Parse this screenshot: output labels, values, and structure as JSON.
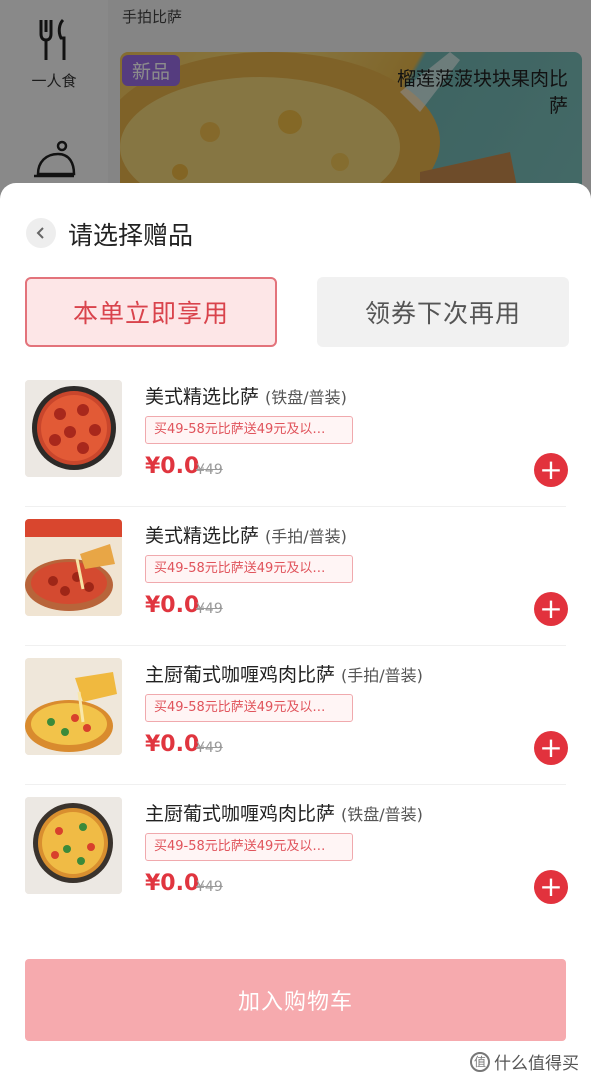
{
  "background": {
    "sidebar": [
      {
        "label": "一人食",
        "icon": "fork-knife-icon"
      },
      {
        "label": "",
        "icon": "cloche-icon"
      }
    ],
    "category_title": "手拍比萨",
    "banner": {
      "tag": "新品",
      "title": "榴莲菠菠块块果肉比萨"
    }
  },
  "sheet": {
    "back_icon": "chevron-left-icon",
    "title": "请选择赠品",
    "tabs": [
      {
        "label": "本单立即享用",
        "active": true
      },
      {
        "label": "领券下次再用",
        "active": false
      }
    ],
    "items": [
      {
        "name": "美式精选比萨",
        "variant": "(铁盘/普装)",
        "promo": "买49-58元比萨送49元及以…",
        "price": "¥0.0",
        "original_price": "¥49",
        "add_icon": "plus-icon"
      },
      {
        "name": "美式精选比萨",
        "variant": "(手拍/普装)",
        "promo": "买49-58元比萨送49元及以…",
        "price": "¥0.0",
        "original_price": "¥49",
        "add_icon": "plus-icon"
      },
      {
        "name": "主厨葡式咖喱鸡肉比萨",
        "variant": "(手拍/普装)",
        "promo": "买49-58元比萨送49元及以…",
        "price": "¥0.0",
        "original_price": "¥49",
        "add_icon": "plus-icon"
      },
      {
        "name": "主厨葡式咖喱鸡肉比萨",
        "variant": "(铁盘/普装)",
        "promo": "买49-58元比萨送49元及以…",
        "price": "¥0.0",
        "original_price": "¥49",
        "add_icon": "plus-icon"
      }
    ],
    "add_to_cart": "加入购物车"
  },
  "watermark": "什么值得买",
  "colors": {
    "accent": "#e2323d",
    "active_tab_bg": "#fde6e7",
    "cart_button": "#f6aaae"
  }
}
